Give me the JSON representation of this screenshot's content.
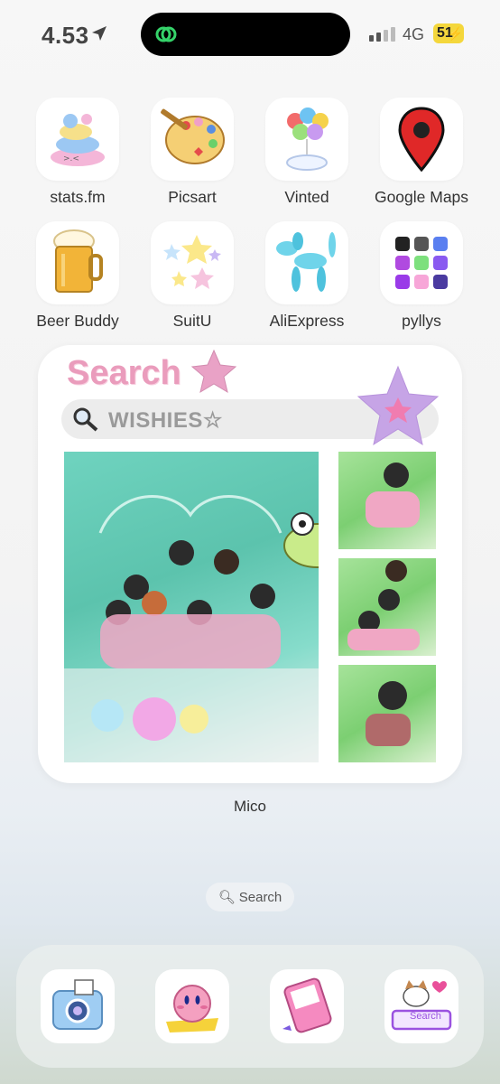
{
  "status": {
    "time": "4.53",
    "network": "4G",
    "battery": "51"
  },
  "apps": [
    {
      "label": "stats.fm",
      "icon": "cat-pile-icon"
    },
    {
      "label": "Picsart",
      "icon": "palette-icon"
    },
    {
      "label": "Vinted",
      "icon": "balloons-icon"
    },
    {
      "label": "Google Maps",
      "icon": "map-pin-icon"
    },
    {
      "label": "Beer Buddy",
      "icon": "beer-mug-icon"
    },
    {
      "label": "SuitU",
      "icon": "stars-icon"
    },
    {
      "label": "AliExpress",
      "icon": "balloon-dog-icon"
    },
    {
      "label": "pyllys",
      "icon": "folder-icon"
    }
  ],
  "widget": {
    "title": "Search",
    "search_text": "WISHIES☆",
    "caption": "Mico"
  },
  "search_pill": {
    "label": "Search"
  },
  "dock": [
    {
      "icon": "camera-icon"
    },
    {
      "icon": "kirby-icon"
    },
    {
      "icon": "phone-icon"
    },
    {
      "icon": "cat-search-icon",
      "label": "Search"
    }
  ],
  "colors": {
    "accent_pink": "#ea9cbc",
    "battery_yellow": "#f4d73c"
  }
}
